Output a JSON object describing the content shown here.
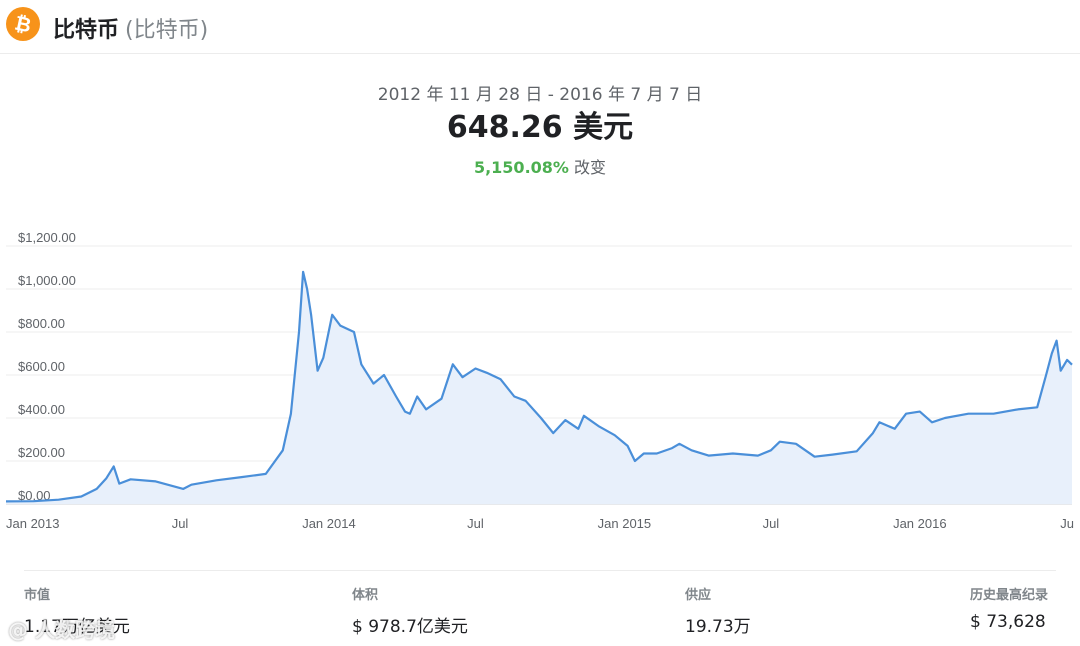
{
  "header": {
    "icon": "bitcoin-icon",
    "icon_color": "#f7931a",
    "name": "比特币",
    "subname": "(比特币)"
  },
  "summary": {
    "date_range": "2012 年 11 月 28 日 - 2016 年 7 月 7 日",
    "price": "648.26 美元",
    "change_pct": "5,150.08%",
    "change_label": "改变",
    "change_color": "#4caf50"
  },
  "chart_data": {
    "type": "area",
    "line_color": "#4a8fd9",
    "fill_color": "#e8f0fb",
    "grid": true,
    "ylim": [
      0,
      1200
    ],
    "y_ticks": [
      {
        "value": 0,
        "label": "$0.00"
      },
      {
        "value": 200,
        "label": "$200.00"
      },
      {
        "value": 400,
        "label": "$400.00"
      },
      {
        "value": 600,
        "label": "$600.00"
      },
      {
        "value": 800,
        "label": "$800.00"
      },
      {
        "value": 1000,
        "label": "$1,000.00"
      },
      {
        "value": 1200,
        "label": "$1,200.00"
      }
    ],
    "x_ticks": [
      {
        "date": "2013-01-01",
        "label": "Jan 2013"
      },
      {
        "date": "2013-07-01",
        "label": "Jul"
      },
      {
        "date": "2014-01-01",
        "label": "Jan 2014"
      },
      {
        "date": "2014-07-01",
        "label": "Jul"
      },
      {
        "date": "2015-01-01",
        "label": "Jan 2015"
      },
      {
        "date": "2015-07-01",
        "label": "Jul"
      },
      {
        "date": "2016-01-01",
        "label": "Jan 2016"
      },
      {
        "date": "2016-07-01",
        "label": "Ju"
      }
    ],
    "series": [
      {
        "x": [
          "2012-11-28",
          "2013-01-01",
          "2013-02-01",
          "2013-03-01",
          "2013-03-20",
          "2013-04-01",
          "2013-04-10",
          "2013-04-17",
          "2013-05-01",
          "2013-06-01",
          "2013-07-05",
          "2013-07-15",
          "2013-08-15",
          "2013-09-15",
          "2013-10-15",
          "2013-11-05",
          "2013-11-15",
          "2013-11-25",
          "2013-11-30",
          "2013-12-05",
          "2013-12-10",
          "2013-12-18",
          "2013-12-25",
          "2014-01-05",
          "2014-01-15",
          "2014-02-01",
          "2014-02-10",
          "2014-02-25",
          "2014-03-10",
          "2014-03-25",
          "2014-04-05",
          "2014-04-11",
          "2014-04-20",
          "2014-05-01",
          "2014-05-20",
          "2014-06-03",
          "2014-06-15",
          "2014-07-01",
          "2014-07-15",
          "2014-08-01",
          "2014-08-18",
          "2014-09-01",
          "2014-09-20",
          "2014-10-05",
          "2014-10-20",
          "2014-11-05",
          "2014-11-12",
          "2014-12-01",
          "2014-12-20",
          "2015-01-05",
          "2015-01-14",
          "2015-01-25",
          "2015-02-10",
          "2015-03-01",
          "2015-03-10",
          "2015-03-25",
          "2015-04-15",
          "2015-05-15",
          "2015-06-15",
          "2015-07-01",
          "2015-07-12",
          "2015-08-01",
          "2015-08-24",
          "2015-09-15",
          "2015-10-15",
          "2015-11-04",
          "2015-11-12",
          "2015-12-01",
          "2015-12-15",
          "2016-01-01",
          "2016-01-16",
          "2016-02-01",
          "2016-03-01",
          "2016-04-01",
          "2016-05-01",
          "2016-05-25",
          "2016-06-05",
          "2016-06-12",
          "2016-06-18",
          "2016-06-23",
          "2016-07-01",
          "2016-07-07"
        ],
        "y": [
          12,
          13,
          20,
          35,
          70,
          120,
          175,
          95,
          115,
          105,
          70,
          90,
          110,
          125,
          140,
          250,
          420,
          800,
          1080,
          1000,
          880,
          620,
          680,
          880,
          830,
          800,
          650,
          560,
          600,
          500,
          430,
          420,
          500,
          440,
          490,
          650,
          590,
          630,
          610,
          580,
          500,
          480,
          400,
          330,
          390,
          350,
          410,
          360,
          320,
          270,
          200,
          235,
          235,
          260,
          280,
          250,
          225,
          235,
          225,
          250,
          290,
          280,
          220,
          230,
          245,
          330,
          380,
          350,
          420,
          430,
          380,
          400,
          420,
          420,
          440,
          450,
          600,
          700,
          760,
          620,
          670,
          648
        ]
      }
    ]
  },
  "stats": [
    {
      "label": "市值",
      "value": "1.17万亿美元"
    },
    {
      "label": "体积",
      "value": "$ 978.7亿美元"
    },
    {
      "label": "供应",
      "value": "19.73万"
    },
    {
      "label": "历史最高纪录",
      "value": "$ 73,628"
    }
  ],
  "watermark": "@ 人数跨境"
}
